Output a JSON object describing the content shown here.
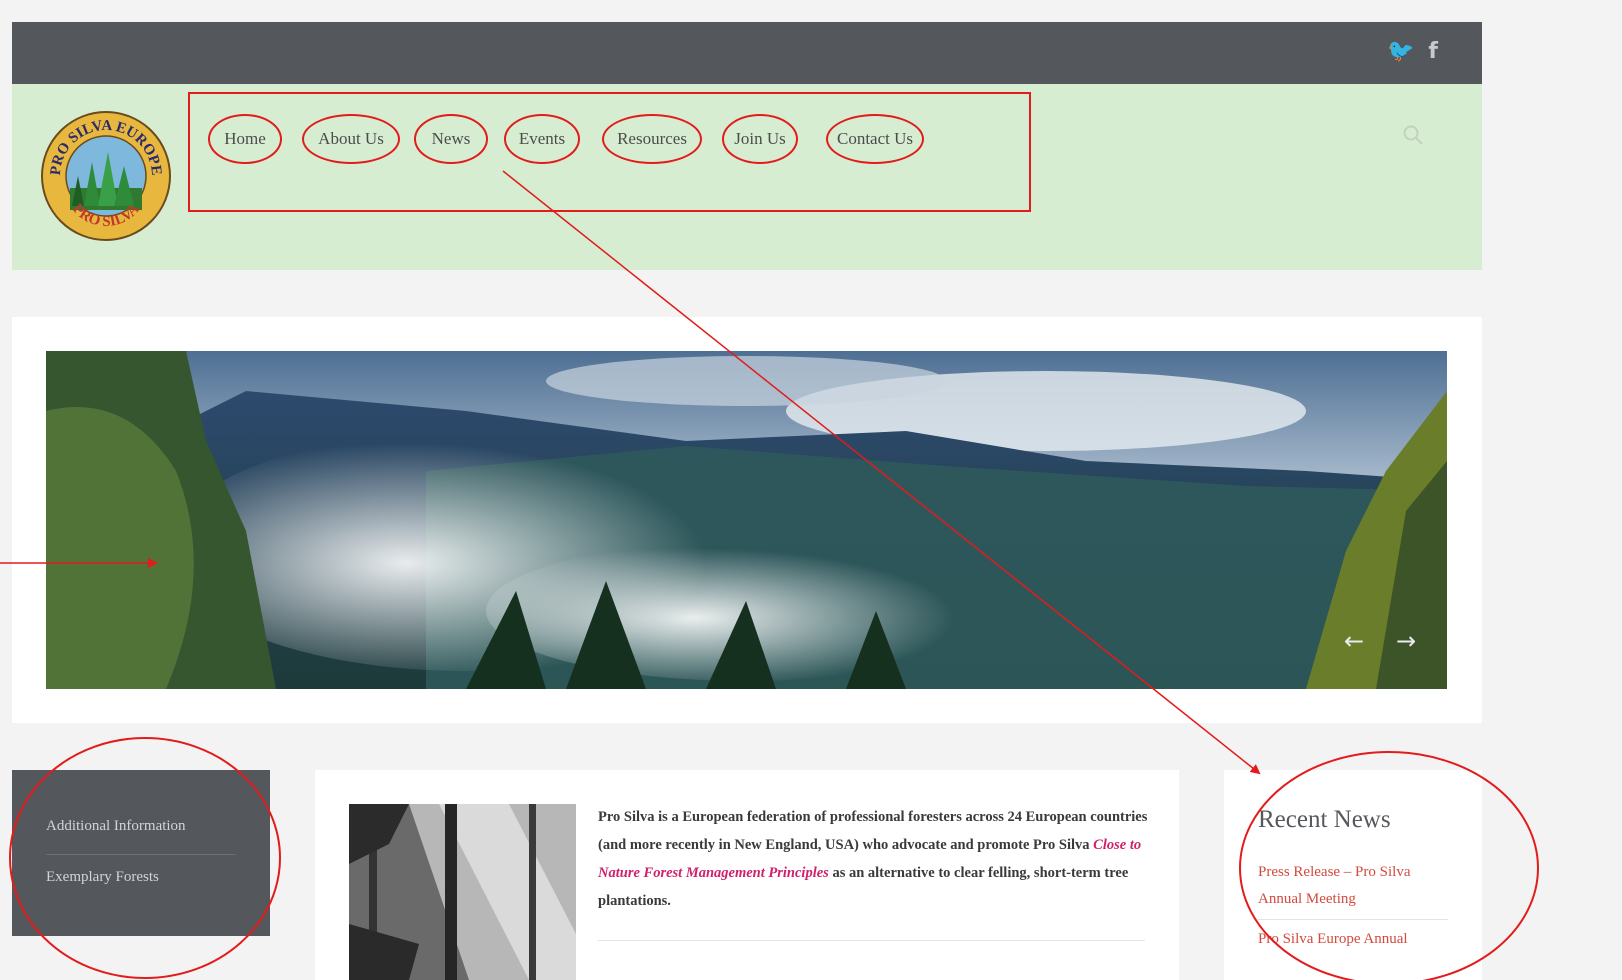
{
  "social": {
    "twitter": "🐦",
    "facebook": "f"
  },
  "logo": {
    "top_text": "PRO SILVA EUROPE",
    "bottom_text": "PRO SILVA"
  },
  "nav": {
    "items": [
      {
        "label": "Home"
      },
      {
        "label": "About Us"
      },
      {
        "label": "News"
      },
      {
        "label": "Events"
      },
      {
        "label": "Resources"
      },
      {
        "label": "Join Us"
      },
      {
        "label": "Contact Us"
      }
    ]
  },
  "slider": {
    "prev": "←",
    "next": "→"
  },
  "sidebar": {
    "items": [
      {
        "label": "Additional Information"
      },
      {
        "label": "Exemplary Forests"
      }
    ]
  },
  "content": {
    "intro_before": "Pro Silva is a European federation of professional foresters across 24 European countries (and more recently in New England, USA) who advocate and promote Pro Silva ",
    "intro_link": "Close to Nature Forest Management Principles",
    "intro_after": " as an alternative to clear felling, short-term tree plantations."
  },
  "news": {
    "title": "Recent News",
    "items": [
      {
        "label": "Press Release – Pro Silva Annual Meeting"
      },
      {
        "label": "Pro Silva Europe Annual"
      }
    ]
  },
  "colors": {
    "topbar": "#54575b",
    "header": "#d6edd2",
    "annotation": "#e21b1b",
    "link": "#d34a3c",
    "highlight": "#d0206b"
  }
}
